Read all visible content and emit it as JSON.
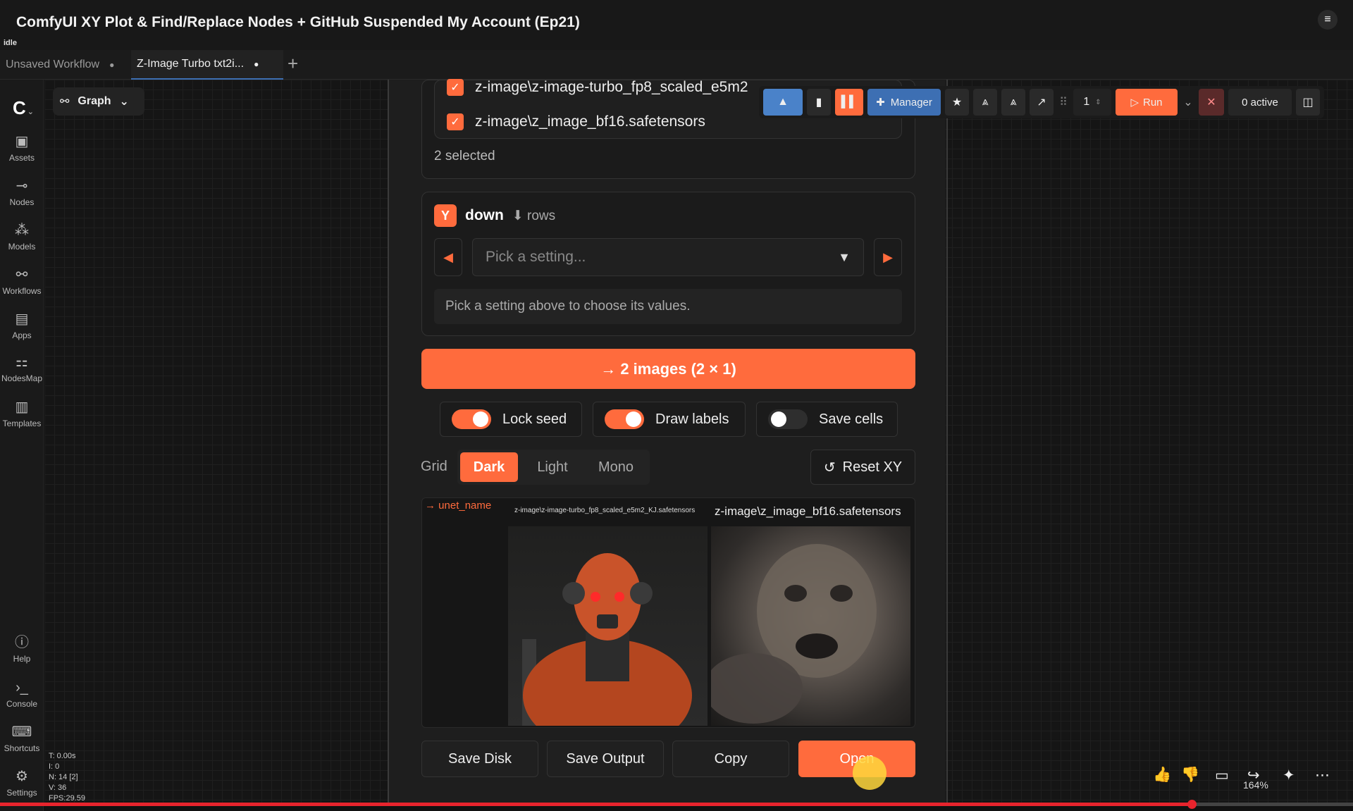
{
  "video": {
    "title": "ComfyUI XY Plot & Find/Replace Nodes + GitHub Suspended My Account (Ep21)",
    "status": "idle"
  },
  "tabs": [
    {
      "label": "Unsaved Workflow",
      "dot": "●"
    },
    {
      "label": "Z-Image Turbo txt2i...",
      "dot": "●"
    }
  ],
  "tab_add": "+",
  "sidebar": {
    "top": [
      {
        "label": "Assets",
        "icon": "assets-icon"
      },
      {
        "label": "Nodes",
        "icon": "nodes-icon"
      },
      {
        "label": "Models",
        "icon": "models-icon"
      },
      {
        "label": "Workflows",
        "icon": "workflows-icon"
      },
      {
        "label": "Apps",
        "icon": "apps-icon"
      },
      {
        "label": "NodesMap",
        "icon": "nodesmap-icon"
      },
      {
        "label": "Templates",
        "icon": "templates-icon"
      }
    ],
    "bottom": [
      {
        "label": "Help",
        "icon": "help-icon"
      },
      {
        "label": "Console",
        "icon": "console-icon"
      },
      {
        "label": "Shortcuts",
        "icon": "keyboard-icon"
      },
      {
        "label": "Settings",
        "icon": "gear-icon"
      }
    ]
  },
  "graph_button": "Graph",
  "toolbar": {
    "manager": "Manager",
    "queue_count": "1",
    "run": "Run",
    "active": "0 active"
  },
  "xy_panel": {
    "x_options": [
      {
        "label": "z-image\\z-image-turbo_fp8_scaled_e5m2",
        "checked": true
      },
      {
        "label": "z-image\\z_image_bf16.safetensors",
        "checked": true
      }
    ],
    "selected_count": "2 selected",
    "y_axis": {
      "badge": "Y",
      "direction": "down",
      "unit": "⬇ rows",
      "select_placeholder": "Pick a setting...",
      "hint": "Pick a setting above to choose its values."
    },
    "generate_label": "→ 2 images (2 × 1)",
    "toggles": [
      {
        "label": "Lock seed",
        "on": true
      },
      {
        "label": "Draw labels",
        "on": true
      },
      {
        "label": "Save cells",
        "on": false
      }
    ],
    "grid_label": "Grid",
    "grid_modes": [
      "Dark",
      "Light",
      "Mono"
    ],
    "grid_active": "Dark",
    "reset_label": "Reset XY",
    "preview": {
      "x_axis_label": "→ unet_name",
      "columns": [
        "z-image\\z-image-turbo_fp8_scaled_e5m2_KJ.safetensors",
        "z-image\\z_image_bf16.safetensors"
      ]
    },
    "actions": [
      "Save Disk",
      "Save Output",
      "Copy",
      "Open"
    ]
  },
  "stats": [
    "T: 0.00s",
    "I: 0",
    "N: 14 [2]",
    "V: 36",
    "FPS:29.59"
  ],
  "zoom_level": "164%",
  "playback_progress": 0.88,
  "colors": {
    "accent": "#ff6b3d",
    "toolbar_blue": "#3d6fb3",
    "progress_red": "#e8242d"
  }
}
